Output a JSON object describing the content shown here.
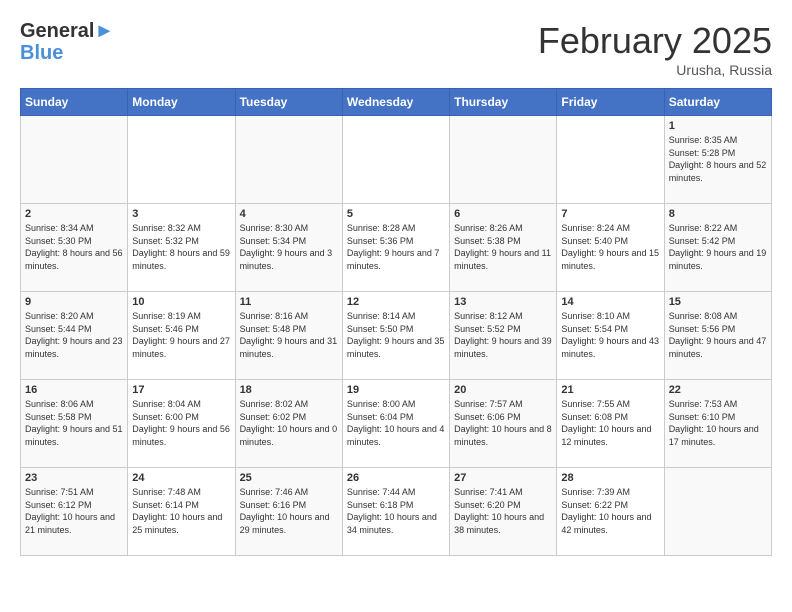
{
  "header": {
    "logo_line1": "General",
    "logo_line2": "Blue",
    "month_title": "February 2025",
    "location": "Urusha, Russia"
  },
  "days_of_week": [
    "Sunday",
    "Monday",
    "Tuesday",
    "Wednesday",
    "Thursday",
    "Friday",
    "Saturday"
  ],
  "weeks": [
    [
      {
        "num": "",
        "info": ""
      },
      {
        "num": "",
        "info": ""
      },
      {
        "num": "",
        "info": ""
      },
      {
        "num": "",
        "info": ""
      },
      {
        "num": "",
        "info": ""
      },
      {
        "num": "",
        "info": ""
      },
      {
        "num": "1",
        "info": "Sunrise: 8:35 AM\nSunset: 5:28 PM\nDaylight: 8 hours and 52 minutes."
      }
    ],
    [
      {
        "num": "2",
        "info": "Sunrise: 8:34 AM\nSunset: 5:30 PM\nDaylight: 8 hours and 56 minutes."
      },
      {
        "num": "3",
        "info": "Sunrise: 8:32 AM\nSunset: 5:32 PM\nDaylight: 8 hours and 59 minutes."
      },
      {
        "num": "4",
        "info": "Sunrise: 8:30 AM\nSunset: 5:34 PM\nDaylight: 9 hours and 3 minutes."
      },
      {
        "num": "5",
        "info": "Sunrise: 8:28 AM\nSunset: 5:36 PM\nDaylight: 9 hours and 7 minutes."
      },
      {
        "num": "6",
        "info": "Sunrise: 8:26 AM\nSunset: 5:38 PM\nDaylight: 9 hours and 11 minutes."
      },
      {
        "num": "7",
        "info": "Sunrise: 8:24 AM\nSunset: 5:40 PM\nDaylight: 9 hours and 15 minutes."
      },
      {
        "num": "8",
        "info": "Sunrise: 8:22 AM\nSunset: 5:42 PM\nDaylight: 9 hours and 19 minutes."
      }
    ],
    [
      {
        "num": "9",
        "info": "Sunrise: 8:20 AM\nSunset: 5:44 PM\nDaylight: 9 hours and 23 minutes."
      },
      {
        "num": "10",
        "info": "Sunrise: 8:19 AM\nSunset: 5:46 PM\nDaylight: 9 hours and 27 minutes."
      },
      {
        "num": "11",
        "info": "Sunrise: 8:16 AM\nSunset: 5:48 PM\nDaylight: 9 hours and 31 minutes."
      },
      {
        "num": "12",
        "info": "Sunrise: 8:14 AM\nSunset: 5:50 PM\nDaylight: 9 hours and 35 minutes."
      },
      {
        "num": "13",
        "info": "Sunrise: 8:12 AM\nSunset: 5:52 PM\nDaylight: 9 hours and 39 minutes."
      },
      {
        "num": "14",
        "info": "Sunrise: 8:10 AM\nSunset: 5:54 PM\nDaylight: 9 hours and 43 minutes."
      },
      {
        "num": "15",
        "info": "Sunrise: 8:08 AM\nSunset: 5:56 PM\nDaylight: 9 hours and 47 minutes."
      }
    ],
    [
      {
        "num": "16",
        "info": "Sunrise: 8:06 AM\nSunset: 5:58 PM\nDaylight: 9 hours and 51 minutes."
      },
      {
        "num": "17",
        "info": "Sunrise: 8:04 AM\nSunset: 6:00 PM\nDaylight: 9 hours and 56 minutes."
      },
      {
        "num": "18",
        "info": "Sunrise: 8:02 AM\nSunset: 6:02 PM\nDaylight: 10 hours and 0 minutes."
      },
      {
        "num": "19",
        "info": "Sunrise: 8:00 AM\nSunset: 6:04 PM\nDaylight: 10 hours and 4 minutes."
      },
      {
        "num": "20",
        "info": "Sunrise: 7:57 AM\nSunset: 6:06 PM\nDaylight: 10 hours and 8 minutes."
      },
      {
        "num": "21",
        "info": "Sunrise: 7:55 AM\nSunset: 6:08 PM\nDaylight: 10 hours and 12 minutes."
      },
      {
        "num": "22",
        "info": "Sunrise: 7:53 AM\nSunset: 6:10 PM\nDaylight: 10 hours and 17 minutes."
      }
    ],
    [
      {
        "num": "23",
        "info": "Sunrise: 7:51 AM\nSunset: 6:12 PM\nDaylight: 10 hours and 21 minutes."
      },
      {
        "num": "24",
        "info": "Sunrise: 7:48 AM\nSunset: 6:14 PM\nDaylight: 10 hours and 25 minutes."
      },
      {
        "num": "25",
        "info": "Sunrise: 7:46 AM\nSunset: 6:16 PM\nDaylight: 10 hours and 29 minutes."
      },
      {
        "num": "26",
        "info": "Sunrise: 7:44 AM\nSunset: 6:18 PM\nDaylight: 10 hours and 34 minutes."
      },
      {
        "num": "27",
        "info": "Sunrise: 7:41 AM\nSunset: 6:20 PM\nDaylight: 10 hours and 38 minutes."
      },
      {
        "num": "28",
        "info": "Sunrise: 7:39 AM\nSunset: 6:22 PM\nDaylight: 10 hours and 42 minutes."
      },
      {
        "num": "",
        "info": ""
      }
    ]
  ]
}
